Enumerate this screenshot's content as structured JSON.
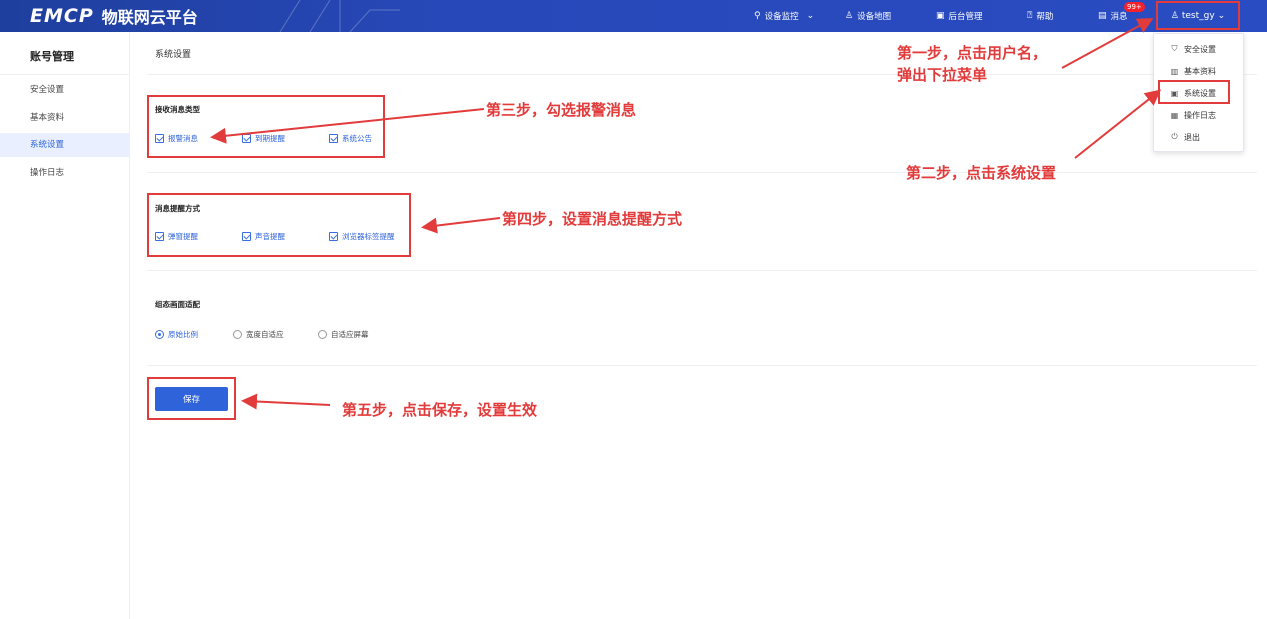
{
  "header": {
    "logo_text": "EMCP",
    "title": "物联网云平台",
    "nav": [
      {
        "label": "设备监控",
        "icon": "location-icon"
      },
      {
        "label": "设备地图",
        "icon": "map-icon"
      },
      {
        "label": "后台管理",
        "icon": "monitor-icon"
      },
      {
        "label": "帮助",
        "icon": "help-icon"
      },
      {
        "label": "消息",
        "icon": "message-icon",
        "badge": "99+"
      }
    ],
    "user": "test_gy"
  },
  "user_menu": [
    {
      "label": "安全设置",
      "icon": "shield-icon"
    },
    {
      "label": "基本资料",
      "icon": "profile-icon"
    },
    {
      "label": "系统设置",
      "icon": "monitor-icon",
      "highlighted": true
    },
    {
      "label": "操作日志",
      "icon": "calendar-icon"
    },
    {
      "label": "退出",
      "icon": "power-icon"
    }
  ],
  "sidebar": {
    "title": "账号管理",
    "items": [
      {
        "label": "安全设置"
      },
      {
        "label": "基本资料"
      },
      {
        "label": "系统设置",
        "active": true
      },
      {
        "label": "操作日志"
      }
    ]
  },
  "main": {
    "page_title": "系统设置",
    "sections": [
      {
        "title": "接收消息类型",
        "options": [
          "报警消息",
          "到期提醒",
          "系统公告"
        ]
      },
      {
        "title": "消息提醒方式",
        "options": [
          "弹窗提醒",
          "声音提醒",
          "浏览器标签提醒"
        ]
      },
      {
        "title": "组态画面适配",
        "options": [
          "原始比例",
          "宽度自适应",
          "自适应屏幕"
        ],
        "selected": "原始比例"
      }
    ],
    "save_label": "保存"
  },
  "annotations": {
    "step1_line1": "第一步，点击用户名，",
    "step1_line2": "弹出下拉菜单",
    "step2": "第二步，点击系统设置",
    "step3": "第三步，勾选报警消息",
    "step4": "第四步，设置消息提醒方式",
    "step5": "第五步，点击保存，设置生效"
  },
  "colors": {
    "header": "#2748b8",
    "accent": "#2e63d9",
    "annotation": "#e23b3b"
  }
}
